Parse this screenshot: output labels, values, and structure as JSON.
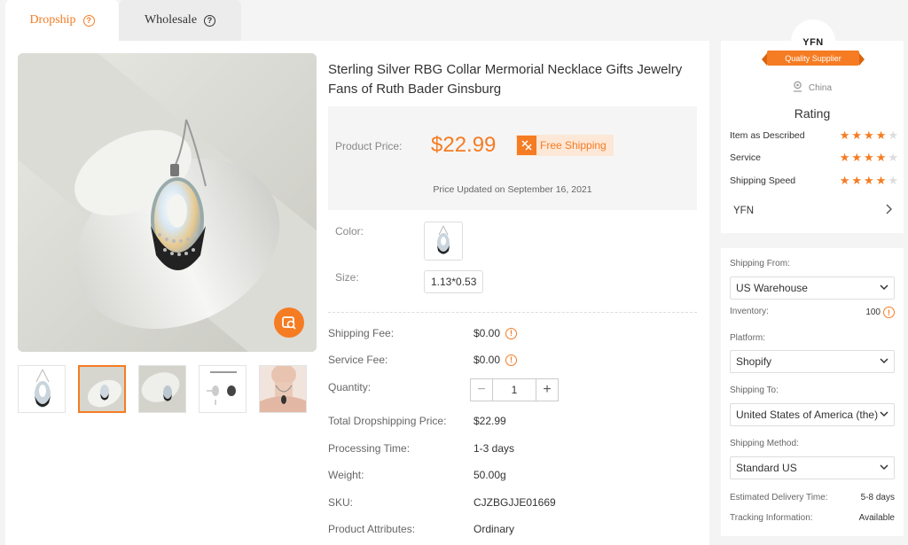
{
  "tabs": [
    {
      "label": "Dropship",
      "active": true
    },
    {
      "label": "Wholesale",
      "active": false
    }
  ],
  "product": {
    "title": "Sterling Silver RBG Collar Mermorial Necklace Gifts Jewelry Fans of Ruth Bader Ginsburg",
    "price_label": "Product Price:",
    "price": "$22.99",
    "free_shipping": "Free Shipping",
    "price_updated": "Price Updated on September 16, 2021",
    "color_label": "Color:",
    "size_label": "Size:",
    "size_value": "1.13*0.53",
    "details": {
      "shipping_fee_label": "Shipping Fee:",
      "shipping_fee": "$0.00",
      "service_fee_label": "Service Fee:",
      "service_fee": "$0.00",
      "quantity_label": "Quantity:",
      "quantity": "1",
      "total_label": "Total Dropshipping Price:",
      "total": "$22.99",
      "processing_label": "Processing Time:",
      "processing": "1-3 days",
      "weight_label": "Weight:",
      "weight": "50.00g",
      "sku_label": "SKU:",
      "sku": "CJZBGJJE01669",
      "attributes_label": "Product Attributes:",
      "attributes": "Ordinary"
    }
  },
  "gallery": {
    "thumbnail_count": 5,
    "selected_index": 1
  },
  "supplier": {
    "logo_text": "YFN",
    "badge": "Quality Supplier",
    "location": "China",
    "rating_title": "Rating",
    "ratings": [
      {
        "label": "Item as Described",
        "stars": 4
      },
      {
        "label": "Service",
        "stars": 4
      },
      {
        "label": "Shipping Speed",
        "stars": 4
      }
    ],
    "store_name": "YFN"
  },
  "shipping": {
    "from_label": "Shipping From:",
    "from_value": "US Warehouse",
    "inventory_label": "Inventory:",
    "inventory_value": "100",
    "platform_label": "Platform:",
    "platform_value": "Shopify",
    "to_label": "Shipping To:",
    "to_value": "United States of America (the)",
    "method_label": "Shipping Method:",
    "method_value": "Standard US",
    "delivery_label": "Estimated Delivery Time:",
    "delivery_value": "5-8 days",
    "tracking_label": "Tracking Information:",
    "tracking_value": "Available"
  },
  "colors": {
    "accent": "#f57c23",
    "panel_bg": "#ffffff",
    "page_bg": "#f4f4f4"
  }
}
